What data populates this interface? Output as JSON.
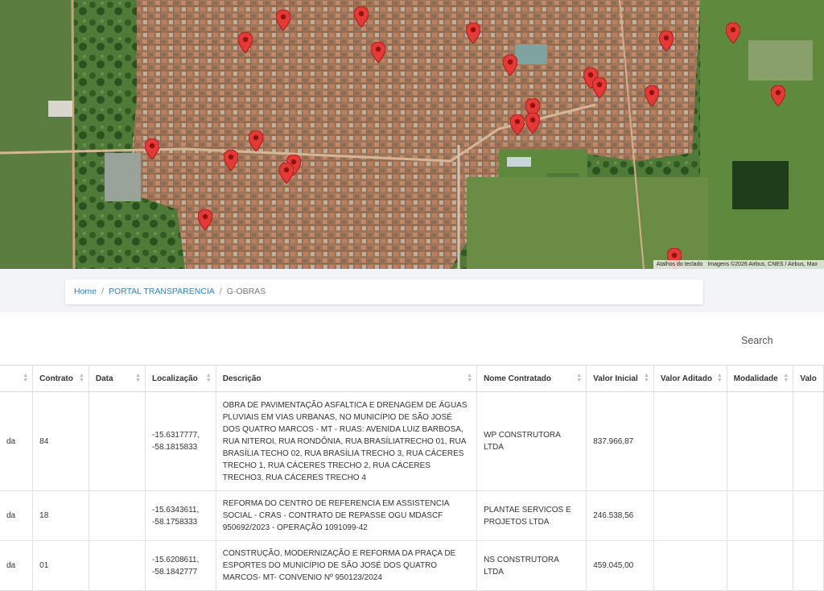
{
  "map": {
    "attribution": [
      "Atalhos do teclado",
      "Imagens ©2026 Airbus, CNES / Airbus, Max"
    ],
    "pin_color": "#e53935",
    "pin_icon": "map-marker-icon"
  },
  "breadcrumb": {
    "home": "Home",
    "portal": "PORTAL TRANSPARENCIA",
    "current": "G-OBRAS",
    "separator": "/"
  },
  "search": {
    "label": "Search"
  },
  "table": {
    "columns": [
      "",
      "Contrato",
      "Data",
      "Localização",
      "Descrição",
      "Nome Contratado",
      "Valor Inicial",
      "Valor Aditado",
      "Modalidade",
      "Valo"
    ],
    "rows": [
      {
        "status": "da",
        "contrato": "84",
        "data": "",
        "localizacao": "-15.6317777, -58.1815833",
        "descricao": "OBRA DE PAVIMENTAÇÃO ASFALTICA E DRENAGEM DE ÁGUAS PLUVIAIS EM VIAS URBANAS, NO MUNICÍPIO DE SÃO JOSÉ DOS QUATRO MARCOS - MT - RUAS: AVENIDA LUIZ BARBOSA, RUA NITEROI, RUA RONDÔNIA, RUA BRASÍLIATRECHO 01, RUA BRASÍLIA TECHO 02, RUA BRASÍLIA TRECHO 3, RUA CÁCERES TRECHO 1, RUA CÁCERES TRECHO 2, RUA CÁCERES TRECHO3, RUA CÁCERES TRECHO 4",
        "contratado": "WP CONSTRUTORA LTDA",
        "valor_inicial": "837.966,87",
        "valor_aditado": "",
        "modalidade": "",
        "valor": ""
      },
      {
        "status": "da",
        "contrato": "18",
        "data": "",
        "localizacao": "-15.6343611, -58.1758333",
        "descricao": "REFORMA DO CENTRO DE REFERENCIA EM ASSISTENCIA SOCIAL - CRAS - CONTRATO DE REPASSE OGU MDASCF 950692/2023 - OPERAÇÃO 1091099-42",
        "contratado": "PLANTAE SERVICOS E PROJETOS LTDA",
        "valor_inicial": "246.538,56",
        "valor_aditado": "",
        "modalidade": "",
        "valor": ""
      },
      {
        "status": "da",
        "contrato": "01",
        "data": "",
        "localizacao": "-15.6208611, -58.1842777",
        "descricao": "CONSTRUÇÃO, MODERNIZAÇÃO E REFORMA DA PRAÇA DE ESPORTES DO MUNICÍPIO DE SÃO JOSÉ DOS QUATRO MARCOS- MT- CONVENIO Nº 950123/2024",
        "contratado": "NS CONSTRUTORA LTDA",
        "valor_inicial": "459.045,00",
        "valor_aditado": "",
        "modalidade": "",
        "valor": ""
      }
    ]
  }
}
